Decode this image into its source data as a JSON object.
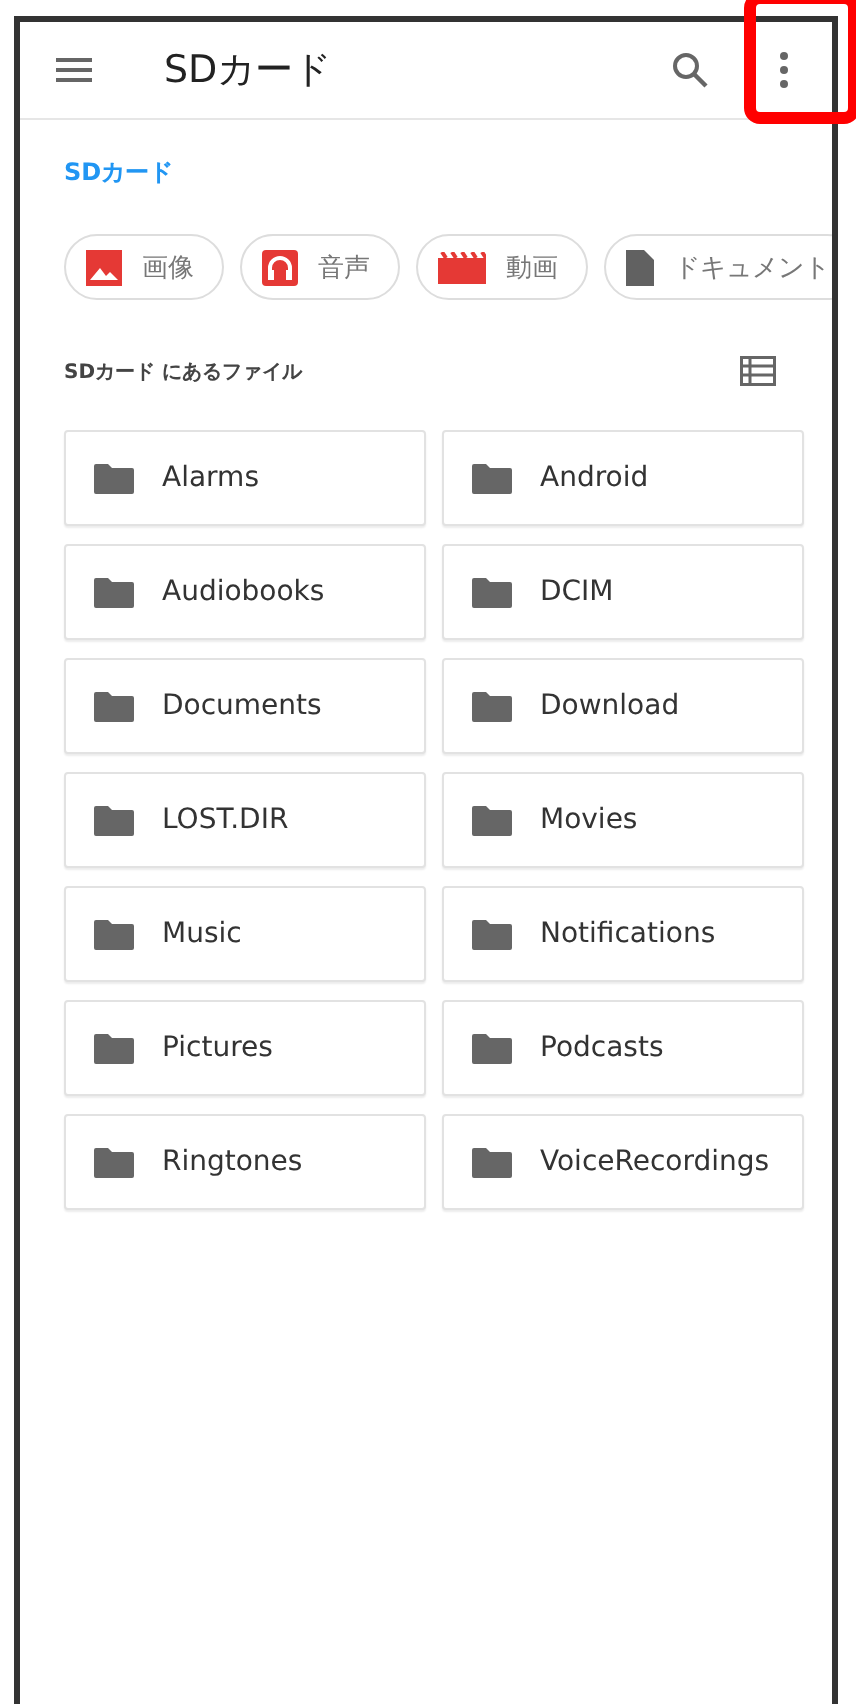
{
  "app_bar": {
    "title": "SDカード",
    "more_highlighted": true
  },
  "breadcrumb": "SDカード",
  "chips": [
    {
      "kind": "image",
      "label": "画像"
    },
    {
      "kind": "audio",
      "label": "音声"
    },
    {
      "kind": "video",
      "label": "動画"
    },
    {
      "kind": "document",
      "label": "ドキュメント"
    }
  ],
  "section_title": "SDカード にあるファイル",
  "folders": [
    {
      "name": "Alarms"
    },
    {
      "name": "Android"
    },
    {
      "name": "Audiobooks"
    },
    {
      "name": "DCIM"
    },
    {
      "name": "Documents"
    },
    {
      "name": "Download"
    },
    {
      "name": "LOST.DIR"
    },
    {
      "name": "Movies"
    },
    {
      "name": "Music"
    },
    {
      "name": "Notifications"
    },
    {
      "name": "Pictures"
    },
    {
      "name": "Podcasts"
    },
    {
      "name": "Ringtones"
    },
    {
      "name": "VoiceRecordings"
    }
  ]
}
